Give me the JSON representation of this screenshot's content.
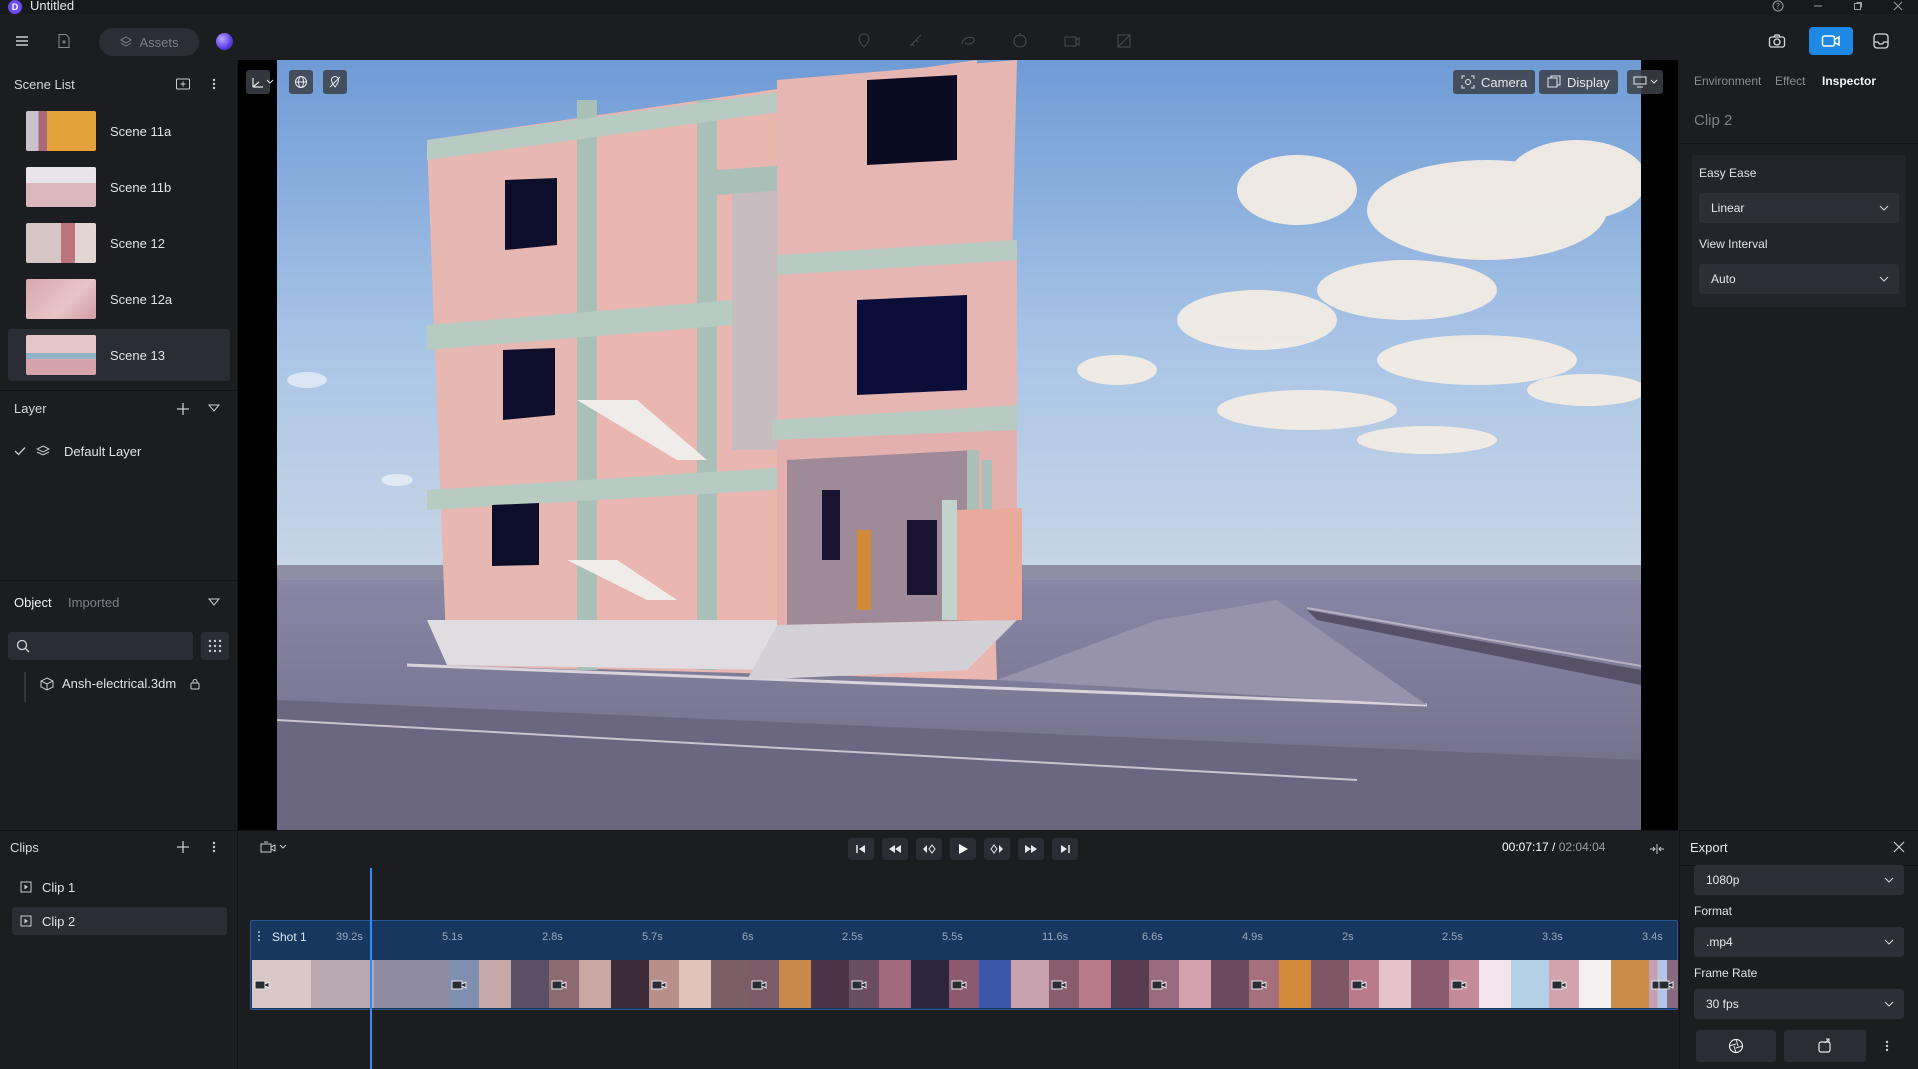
{
  "window": {
    "logo": "D",
    "title": "Untitled"
  },
  "toolbar": {
    "assets_label": "Assets"
  },
  "scene_list": {
    "title": "Scene List",
    "scenes": [
      {
        "name": "Scene 11a"
      },
      {
        "name": "Scene 11b"
      },
      {
        "name": "Scene 12"
      },
      {
        "name": "Scene 12a"
      },
      {
        "name": "Scene 13"
      }
    ]
  },
  "layer": {
    "title": "Layer",
    "items": [
      {
        "name": "Default Layer"
      }
    ]
  },
  "object": {
    "tabs": [
      "Object",
      "Imported"
    ],
    "search_placeholder": "",
    "items": [
      {
        "name": "Ansh-electrical.3dm"
      }
    ]
  },
  "viewport": {
    "camera_label": "Camera",
    "display_label": "Display"
  },
  "inspector": {
    "tabs": [
      "Environment",
      "Effect",
      "Inspector"
    ],
    "clip_title": "Clip 2",
    "easy_ease_label": "Easy Ease",
    "easy_ease_value": "Linear",
    "view_interval_label": "View Interval",
    "view_interval_value": "Auto"
  },
  "clips": {
    "title": "Clips",
    "items": [
      {
        "name": "Clip 1"
      },
      {
        "name": "Clip 2"
      }
    ]
  },
  "timeline": {
    "current_time": "00:07:17",
    "separator": " / ",
    "total_time": "02:04:04",
    "shot_name": "Shot 1",
    "segment_durations": [
      "39.2s",
      "5.1s",
      "2.8s",
      "5.7s",
      "6s",
      "2.5s",
      "5.5s",
      "11.6s",
      "6.6s",
      "4.9s",
      "2s",
      "2.5s",
      "3.3s",
      "3.4s"
    ]
  },
  "export": {
    "title": "Export",
    "resolution_value": "1080p",
    "format_label": "Format",
    "format_value": ".mp4",
    "frame_rate_label": "Frame Rate",
    "frame_rate_value": "30 fps"
  }
}
